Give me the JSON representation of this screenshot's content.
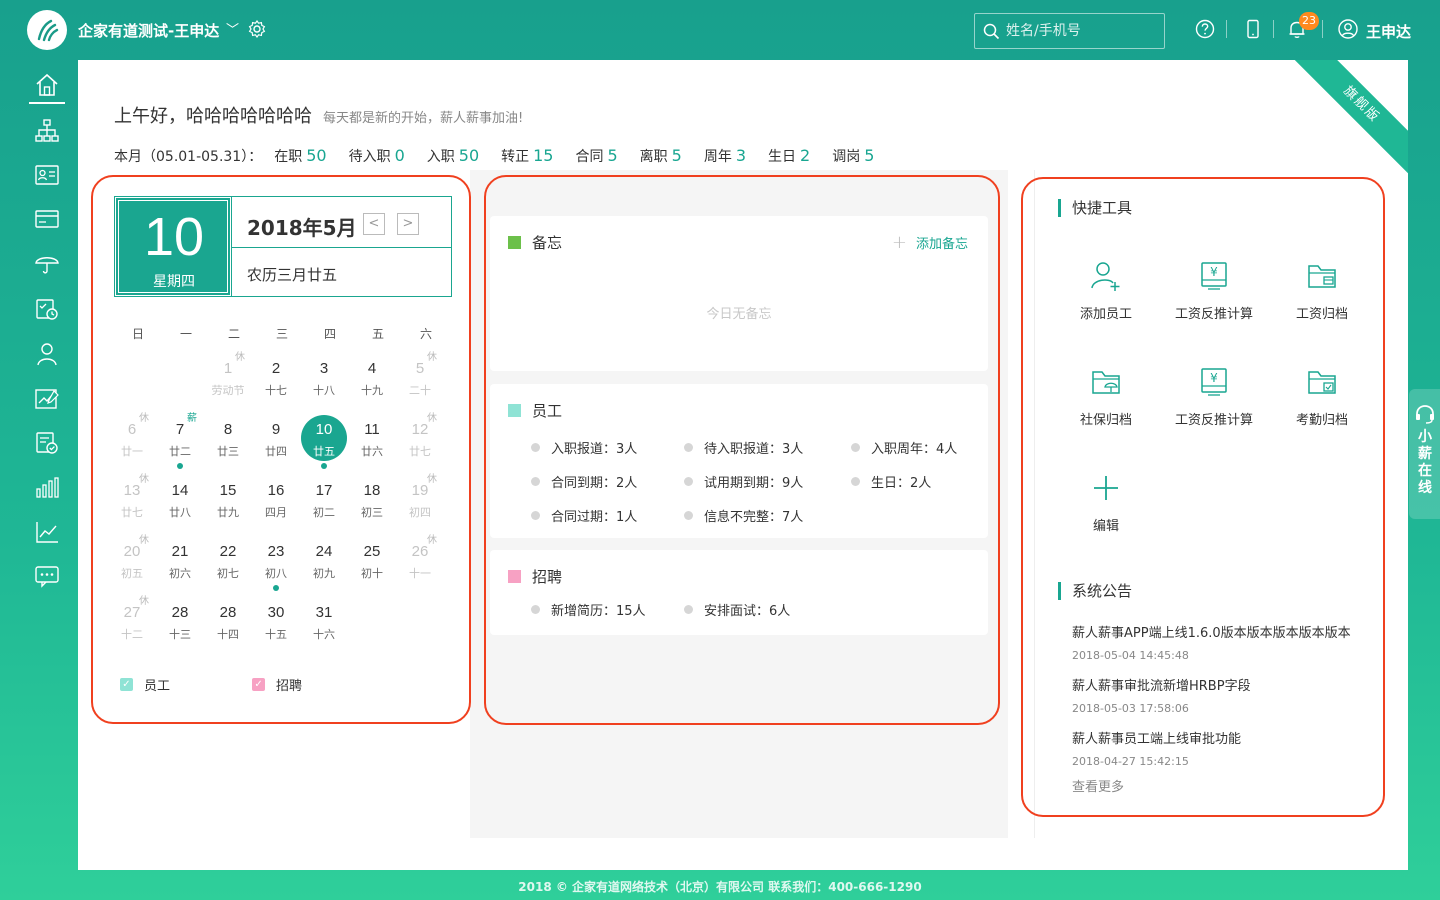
{
  "header": {
    "company": "企家有道测试-王申达",
    "search_placeholder": "姓名/手机号",
    "notification_count": "23",
    "user_name": "王申达"
  },
  "ribbon": "旗舰版",
  "greeting": {
    "title": "上午好，哈哈哈哈哈哈哈",
    "subtitle": "每天都是新的开始，薪人薪事加油!"
  },
  "stats": {
    "period": "本月（05.01-05.31）：",
    "items": [
      {
        "label": "在职",
        "value": "50"
      },
      {
        "label": "待入职",
        "value": "0"
      },
      {
        "label": "入职",
        "value": "50"
      },
      {
        "label": "转正",
        "value": "15"
      },
      {
        "label": "合同",
        "value": "5"
      },
      {
        "label": "离职",
        "value": "5"
      },
      {
        "label": "周年",
        "value": "3"
      },
      {
        "label": "生日",
        "value": "2"
      },
      {
        "label": "调岗",
        "value": "5"
      }
    ]
  },
  "calendar": {
    "day": "10",
    "weekday": "星期四",
    "month_title": "2018年5月",
    "prev": "<",
    "next": ">",
    "lunar": "农历三月廿五",
    "weekdays": [
      "日",
      "一",
      "二",
      "三",
      "四",
      "五",
      "六"
    ],
    "weeks": [
      [
        null,
        null,
        {
          "d": "1",
          "l": "劳动节",
          "tag": "休",
          "muted": true
        },
        {
          "d": "2",
          "l": "十七"
        },
        {
          "d": "3",
          "l": "十八"
        },
        {
          "d": "4",
          "l": "十九"
        },
        {
          "d": "5",
          "l": "二十",
          "tag": "休",
          "muted": true
        }
      ],
      [
        {
          "d": "6",
          "l": "廿一",
          "tag": "休",
          "muted": true
        },
        {
          "d": "7",
          "l": "廿二",
          "tag": "薪",
          "pay": true,
          "dot": true
        },
        {
          "d": "8",
          "l": "廿三"
        },
        {
          "d": "9",
          "l": "廿四"
        },
        {
          "d": "10",
          "l": "廿五",
          "today": true,
          "dot": true
        },
        {
          "d": "11",
          "l": "廿六"
        },
        {
          "d": "12",
          "l": "廿七",
          "tag": "休",
          "muted": true
        }
      ],
      [
        {
          "d": "13",
          "l": "廿七",
          "tag": "休",
          "muted": true
        },
        {
          "d": "14",
          "l": "廿八"
        },
        {
          "d": "15",
          "l": "廿九"
        },
        {
          "d": "16",
          "l": "四月"
        },
        {
          "d": "17",
          "l": "初二"
        },
        {
          "d": "18",
          "l": "初三"
        },
        {
          "d": "19",
          "l": "初四",
          "tag": "休",
          "muted": true
        }
      ],
      [
        {
          "d": "20",
          "l": "初五",
          "tag": "休",
          "muted": true
        },
        {
          "d": "21",
          "l": "初六"
        },
        {
          "d": "22",
          "l": "初七"
        },
        {
          "d": "23",
          "l": "初八",
          "dot": true
        },
        {
          "d": "24",
          "l": "初九"
        },
        {
          "d": "25",
          "l": "初十"
        },
        {
          "d": "26",
          "l": "十一",
          "tag": "休",
          "muted": true
        }
      ],
      [
        {
          "d": "27",
          "l": "十二",
          "tag": "休",
          "muted": true
        },
        {
          "d": "28",
          "l": "十三"
        },
        {
          "d": "28",
          "l": "十四"
        },
        {
          "d": "30",
          "l": "十五"
        },
        {
          "d": "31",
          "l": "十六"
        },
        null,
        null
      ]
    ],
    "legend": [
      {
        "label": "员工",
        "color": "#8fe3d5"
      },
      {
        "label": "招聘",
        "color": "#f7a1c3"
      }
    ]
  },
  "memo": {
    "title": "备忘",
    "add_label": "添加备忘",
    "empty": "今日无备忘",
    "color": "#6cc04a"
  },
  "employee": {
    "title": "员工",
    "color": "#8fe3d5",
    "items": [
      {
        "label": "入职报道：",
        "value": "3人"
      },
      {
        "label": "待入职报道：",
        "value": "3人"
      },
      {
        "label": "入职周年：",
        "value": "4人"
      },
      {
        "label": "合同到期：",
        "value": "2人"
      },
      {
        "label": "试用期到期：",
        "value": "9人"
      },
      {
        "label": "生日：",
        "value": "2人"
      },
      {
        "label": "合同过期：",
        "value": "1人"
      },
      {
        "label": "信息不完整：",
        "value": "7人"
      }
    ]
  },
  "recruit": {
    "title": "招聘",
    "color": "#f7a1c3",
    "items": [
      {
        "label": "新增简历：",
        "value": "15人"
      },
      {
        "label": "安排面试：",
        "value": "6人"
      }
    ]
  },
  "quick_tools": {
    "title": "快捷工具",
    "items": [
      {
        "label": "添加员工",
        "icon": "add-user-icon"
      },
      {
        "label": "工资反推计算",
        "icon": "salary-calc-icon"
      },
      {
        "label": "工资归档",
        "icon": "salary-archive-icon"
      },
      {
        "label": "社保归档",
        "icon": "social-security-archive-icon"
      },
      {
        "label": "工资反推计算",
        "icon": "salary-calc-icon"
      },
      {
        "label": "考勤归档",
        "icon": "attendance-archive-icon"
      },
      {
        "label": "编辑",
        "icon": "plus-icon"
      }
    ]
  },
  "announcements": {
    "title": "系统公告",
    "items": [
      {
        "title": "薪人薪事APP端上线1.6.0版本版本版本版本版本",
        "time": "2018-05-04 14:45:48"
      },
      {
        "title": "薪人薪事审批流新增HRBP字段",
        "time": "2018-05-03 17:58:06"
      },
      {
        "title": "薪人薪事员工端上线审批功能",
        "time": "2018-04-27 15:42:15"
      }
    ],
    "more": "查看更多"
  },
  "chat": {
    "label": "小薪在线"
  },
  "footer": "2018 © 企家有道网络技术（北京）有限公司    联系我们：400-666-1290"
}
